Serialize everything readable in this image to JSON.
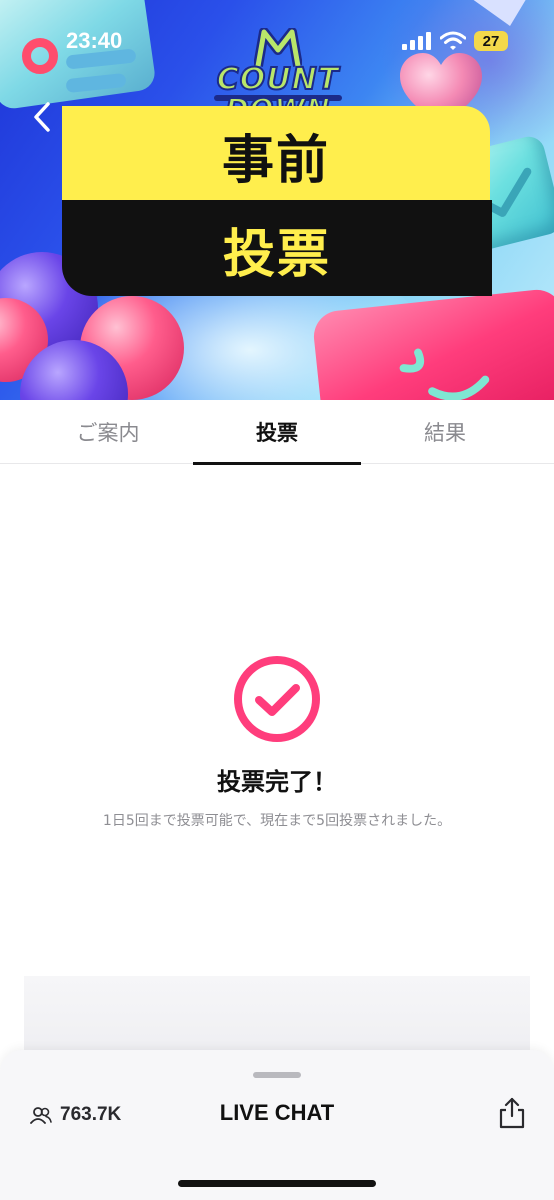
{
  "status_bar": {
    "time": "23:40",
    "battery": "27",
    "icons": [
      "signal-icon",
      "wifi-icon",
      "battery-icon"
    ]
  },
  "banner": {
    "logo_top": "M",
    "logo_count": "COUNT",
    "logo_down": "DOWN",
    "title_line1": "事前",
    "title_line2": "投票",
    "colors": {
      "yellow": "#ffee4d",
      "black": "#111111",
      "pink": "#ff3d7c",
      "blue": "#2a50ea"
    }
  },
  "tabs": [
    {
      "label": "ご案内",
      "active": false
    },
    {
      "label": "投票",
      "active": true
    },
    {
      "label": "結果",
      "active": false
    }
  ],
  "vote_result": {
    "icon": "check-circle-icon",
    "title": "投票完了！",
    "description": "1日5回まで投票可能で、現在まで5回投票されました。",
    "accent_color": "#ff3d7c"
  },
  "bottom_sheet": {
    "viewer_count": "763.7K",
    "title": "LIVE CHAT",
    "icons": [
      "viewers-icon",
      "share-icon"
    ]
  }
}
